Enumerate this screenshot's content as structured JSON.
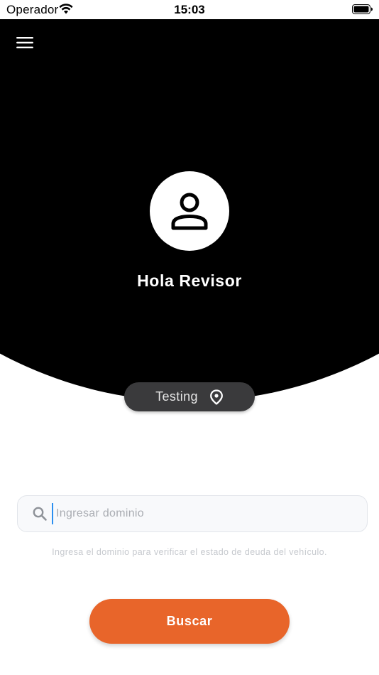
{
  "status_bar": {
    "carrier": "Operador",
    "time": "15:03",
    "wifi_icon": "wifi-icon",
    "battery_icon": "battery-icon"
  },
  "header": {
    "menu_icon": "hamburger-menu-icon",
    "avatar_icon": "person-icon",
    "greeting": "Hola Revisor"
  },
  "location": {
    "label": "Testing",
    "icon": "map-pin-icon"
  },
  "search": {
    "icon": "search-icon",
    "placeholder": "Ingresar dominio",
    "value": "",
    "helper": "Ingresa el dominio para verificar el estado de deuda del vehículo."
  },
  "actions": {
    "search_button_label": "Buscar"
  },
  "colors": {
    "header_bg": "#000000",
    "pill_bg": "#3a3a3c",
    "accent": "#e8652a",
    "cursor": "#2b8ff0"
  }
}
